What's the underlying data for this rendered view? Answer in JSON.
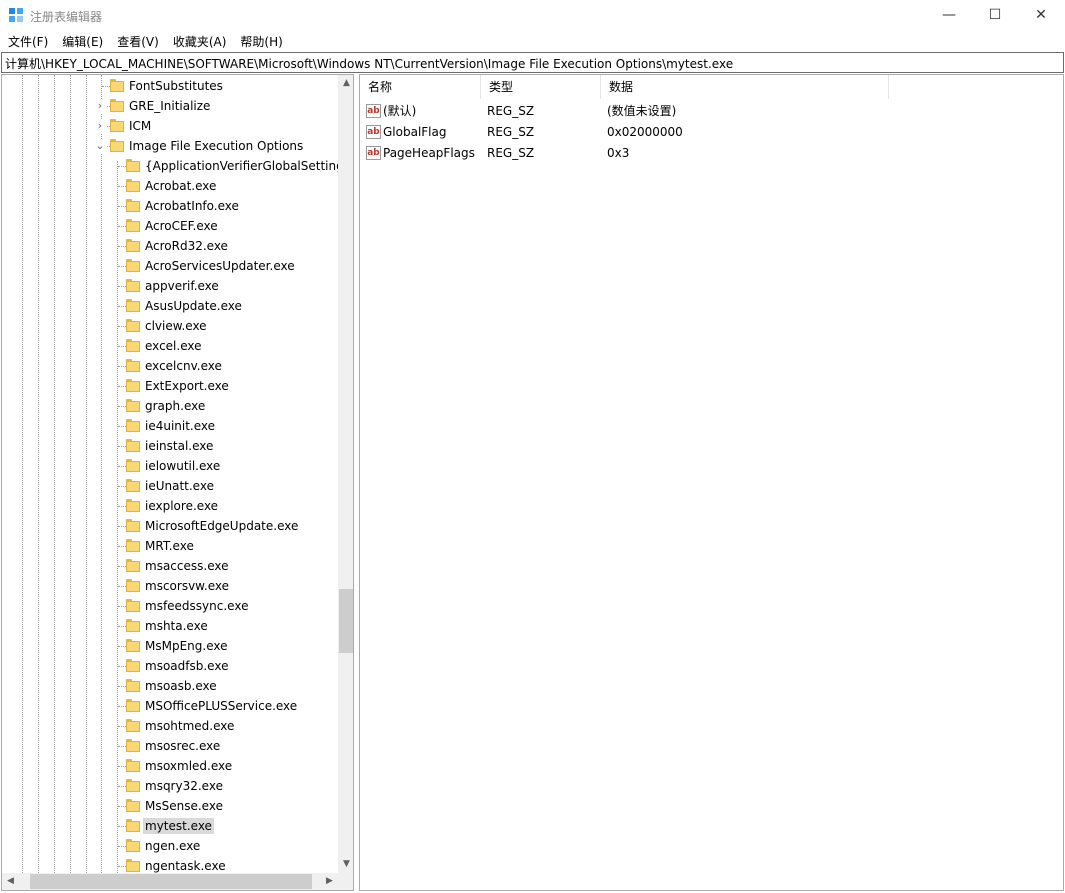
{
  "window": {
    "title": "注册表编辑器",
    "minimize_glyph": "—",
    "maximize_glyph": "☐",
    "close_glyph": "✕"
  },
  "menu": [
    "文件(F)",
    "编辑(E)",
    "查看(V)",
    "收藏夹(A)",
    "帮助(H)"
  ],
  "address": "计算机\\HKEY_LOCAL_MACHINE\\SOFTWARE\\Microsoft\\Windows NT\\CurrentVersion\\Image File Execution Options\\mytest.exe",
  "tree": {
    "parents": [
      {
        "label": "FontSubstitutes",
        "expander": ""
      },
      {
        "label": "GRE_Initialize",
        "expander": "›"
      },
      {
        "label": "ICM",
        "expander": "›"
      },
      {
        "label": "Image File Execution Options",
        "expander": "⌄"
      }
    ],
    "children": [
      "{ApplicationVerifierGlobalSettings}",
      "Acrobat.exe",
      "AcrobatInfo.exe",
      "AcroCEF.exe",
      "AcroRd32.exe",
      "AcroServicesUpdater.exe",
      "appverif.exe",
      "AsusUpdate.exe",
      "clview.exe",
      "excel.exe",
      "excelcnv.exe",
      "ExtExport.exe",
      "graph.exe",
      "ie4uinit.exe",
      "ieinstal.exe",
      "ielowutil.exe",
      "ieUnatt.exe",
      "iexplore.exe",
      "MicrosoftEdgeUpdate.exe",
      "MRT.exe",
      "msaccess.exe",
      "mscorsvw.exe",
      "msfeedssync.exe",
      "mshta.exe",
      "MsMpEng.exe",
      "msoadfsb.exe",
      "msoasb.exe",
      "MSOfficePLUSService.exe",
      "msohtmed.exe",
      "msosrec.exe",
      "msoxmled.exe",
      "msqry32.exe",
      "MsSense.exe",
      "mytest.exe",
      "ngen.exe",
      "ngentask.exe"
    ],
    "selected": "mytest.exe"
  },
  "scroll": {
    "up": "▲",
    "down": "▼",
    "left": "◀",
    "right": "▶"
  },
  "list": {
    "headers": {
      "name": "名称",
      "type": "类型",
      "data": "数据"
    },
    "icon_text": "ab",
    "rows": [
      {
        "name": "(默认)",
        "type": "REG_SZ",
        "data": "(数值未设置)"
      },
      {
        "name": "GlobalFlag",
        "type": "REG_SZ",
        "data": "0x02000000"
      },
      {
        "name": "PageHeapFlags",
        "type": "REG_SZ",
        "data": "0x3"
      }
    ]
  },
  "colors": {
    "folder": "#f8d775",
    "selection": "#d9d9d9",
    "string_icon": "#c0392b"
  }
}
